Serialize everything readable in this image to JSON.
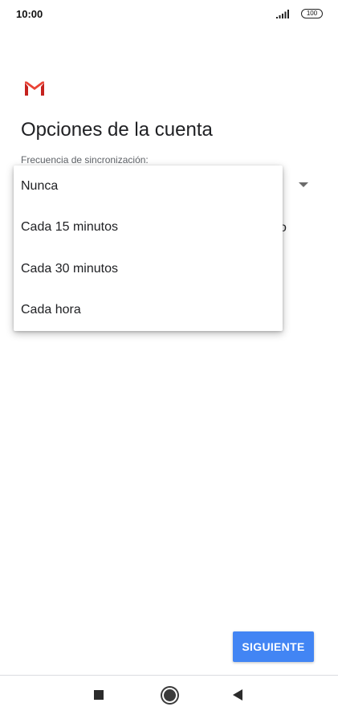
{
  "status_bar": {
    "time": "10:00",
    "signal_icon": "signal-bars-icon",
    "battery": "100"
  },
  "app": {
    "logo_icon": "gmail-logo-icon",
    "title": "Opciones de la cuenta",
    "field_label": "Frecuencia de sincronización:",
    "behind_glyph": "o"
  },
  "popup": {
    "options": [
      {
        "label": "Nunca"
      },
      {
        "label": "Cada 15 minutos"
      },
      {
        "label": "Cada 30 minutos"
      },
      {
        "label": "Cada hora"
      }
    ]
  },
  "footer": {
    "next_label": "SIGUIENTE",
    "accent_color": "#4285f4"
  },
  "nav_bar": {
    "recents_icon": "square-recents-icon",
    "home_icon": "circle-home-icon",
    "back_icon": "triangle-back-icon"
  }
}
